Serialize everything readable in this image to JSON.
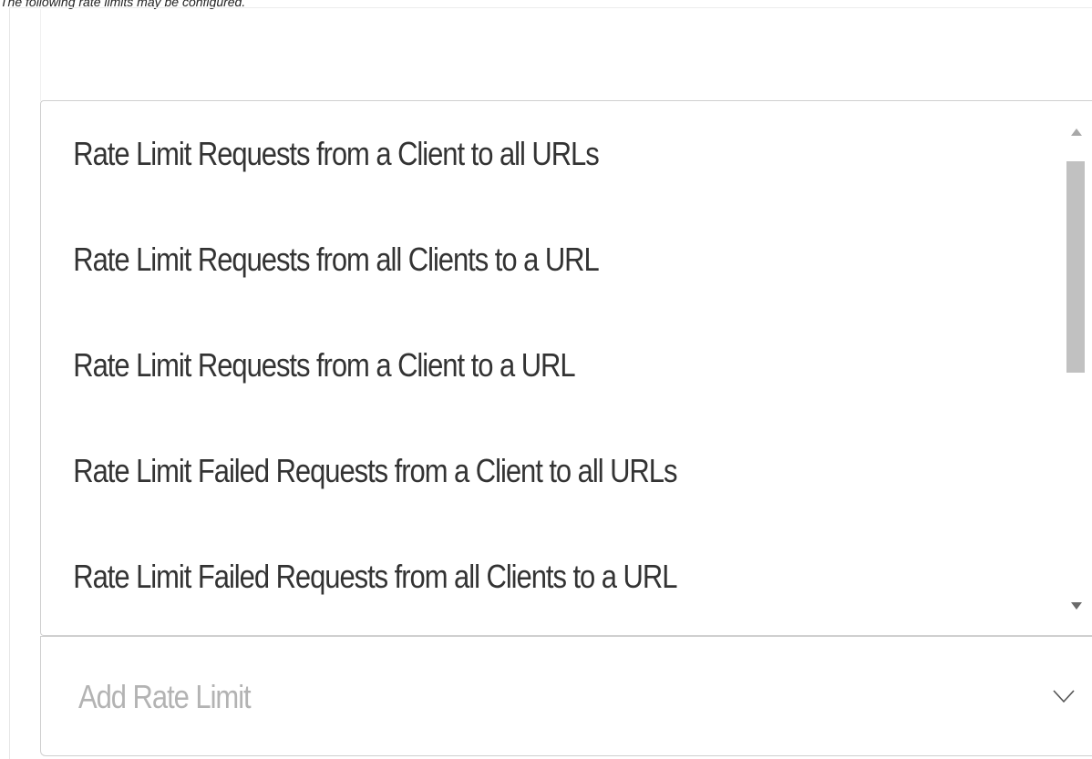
{
  "note": {
    "text": "The following rate limits may be configured."
  },
  "dropdown": {
    "options": [
      "Rate Limit Requests from a Client to all URLs",
      "Rate Limit Requests from all Clients to a URL",
      "Rate Limit Requests from a Client to a URL",
      "Rate Limit Failed Requests from a Client to all URLs",
      "Rate Limit Failed Requests from all Clients to a URL"
    ],
    "scroll_position": 0.0
  },
  "add_rate_limit": {
    "placeholder": "Add Rate Limit",
    "icon": "chevron-down-icon"
  },
  "colors": {
    "text": "#333333",
    "placeholder": "#b3b3b3",
    "border": "#cfcfcf",
    "scroll_thumb": "#c1c1c1"
  }
}
